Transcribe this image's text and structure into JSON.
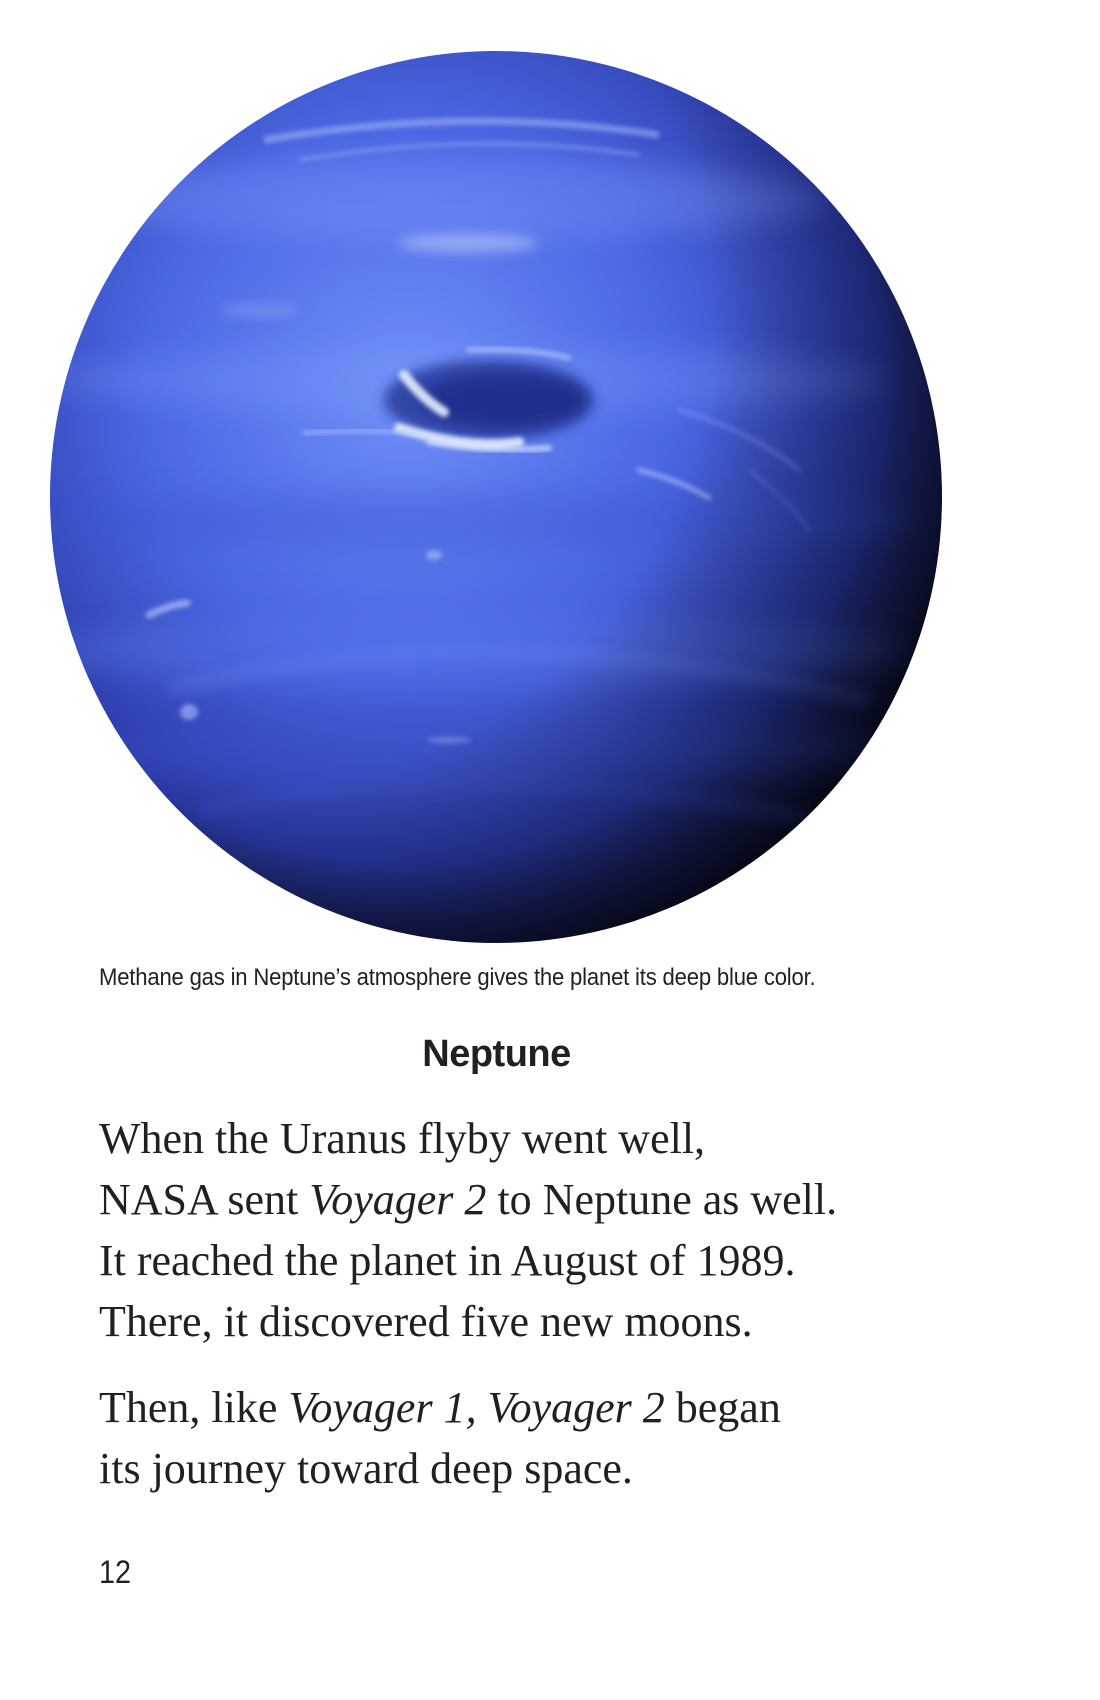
{
  "figure": {
    "subject": "planet-neptune",
    "colors": {
      "highlight": "#6f8ff8",
      "mid": "#4a67e2",
      "deep": "#2b3aa6",
      "shadow": "#060816",
      "clouds": "#dfeaff"
    }
  },
  "caption": "Methane gas in Neptune’s atmosphere gives the planet its deep blue color.",
  "heading": "Neptune",
  "paragraphs": [
    {
      "lines": [
        [
          {
            "text": "When the Uranus flyby went well,"
          }
        ],
        [
          {
            "text": "NASA sent "
          },
          {
            "text": "Voyager 2",
            "italic": true
          },
          {
            "text": " to Neptune as well."
          }
        ],
        [
          {
            "text": "It reached the planet in August of 1989."
          }
        ],
        [
          {
            "text": "There, it discovered five new moons."
          }
        ]
      ]
    },
    {
      "lines": [
        [
          {
            "text": "Then, like "
          },
          {
            "text": "Voyager 1, Voyager 2",
            "italic": true
          },
          {
            "text": " began"
          }
        ],
        [
          {
            "text": "its journey toward deep space."
          }
        ]
      ]
    }
  ],
  "page_number": "12"
}
